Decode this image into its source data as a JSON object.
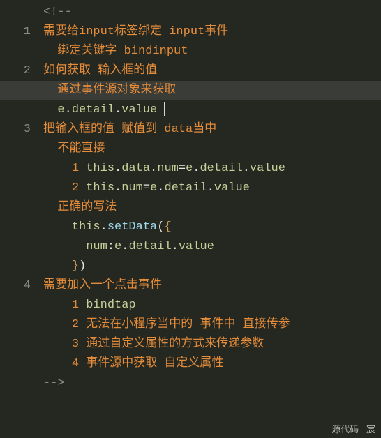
{
  "lines": [
    {
      "num": "",
      "hl": false,
      "segs": [
        {
          "c": "g",
          "t": "<!-- "
        }
      ],
      "indent": -1
    },
    {
      "num": "1",
      "hl": false,
      "segs": [
        {
          "c": "o",
          "t": "需要给input标签绑定 input事件"
        }
      ],
      "indent": 0
    },
    {
      "num": "",
      "hl": false,
      "segs": [
        {
          "c": "o",
          "t": "绑定关键字 bindinput"
        }
      ],
      "indent": 1
    },
    {
      "num": "2",
      "hl": false,
      "segs": [
        {
          "c": "o",
          "t": "如何获取 输入框的值"
        }
      ],
      "indent": 0
    },
    {
      "num": "",
      "hl": true,
      "segs": [
        {
          "c": "o",
          "t": "通过事件源对象来获取"
        }
      ],
      "indent": 1
    },
    {
      "num": "",
      "hl": false,
      "segs": [
        {
          "c": "lg",
          "t": "e"
        },
        {
          "c": "w",
          "t": "."
        },
        {
          "c": "lg",
          "t": "detail"
        },
        {
          "c": "w",
          "t": "."
        },
        {
          "c": "lg",
          "t": "value"
        }
      ],
      "indent": 1,
      "cursor": true
    },
    {
      "num": "3",
      "hl": false,
      "segs": [
        {
          "c": "o",
          "t": "把输入框的值 赋值到 data当中"
        }
      ],
      "indent": 0
    },
    {
      "num": "",
      "hl": false,
      "segs": [
        {
          "c": "o",
          "t": "不能直接 "
        }
      ],
      "indent": 1
    },
    {
      "num": "",
      "hl": false,
      "segs": [
        {
          "c": "o",
          "t": "1 "
        },
        {
          "c": "lg",
          "t": "this"
        },
        {
          "c": "w",
          "t": "."
        },
        {
          "c": "lg",
          "t": "data"
        },
        {
          "c": "w",
          "t": "."
        },
        {
          "c": "lg",
          "t": "num"
        },
        {
          "c": "w",
          "t": "="
        },
        {
          "c": "lg",
          "t": "e"
        },
        {
          "c": "w",
          "t": "."
        },
        {
          "c": "lg",
          "t": "detail"
        },
        {
          "c": "w",
          "t": "."
        },
        {
          "c": "lg",
          "t": "value"
        }
      ],
      "indent": 2
    },
    {
      "num": "",
      "hl": false,
      "segs": [
        {
          "c": "o",
          "t": "2 "
        },
        {
          "c": "lg",
          "t": "this"
        },
        {
          "c": "w",
          "t": "."
        },
        {
          "c": "lg",
          "t": "num"
        },
        {
          "c": "w",
          "t": "="
        },
        {
          "c": "lg",
          "t": "e"
        },
        {
          "c": "w",
          "t": "."
        },
        {
          "c": "lg",
          "t": "detail"
        },
        {
          "c": "w",
          "t": "."
        },
        {
          "c": "lg",
          "t": "value"
        }
      ],
      "indent": 2
    },
    {
      "num": "",
      "hl": false,
      "segs": [
        {
          "c": "o",
          "t": "正确的写法"
        }
      ],
      "indent": 1
    },
    {
      "num": "",
      "hl": false,
      "segs": [
        {
          "c": "lg",
          "t": "this"
        },
        {
          "c": "w",
          "t": "."
        },
        {
          "c": "bl",
          "t": "setData"
        },
        {
          "c": "w",
          "t": "("
        },
        {
          "c": "br",
          "t": "{"
        }
      ],
      "indent": 2
    },
    {
      "num": "",
      "hl": false,
      "segs": [
        {
          "c": "lg",
          "t": "num"
        },
        {
          "c": "w",
          "t": ":"
        },
        {
          "c": "lg",
          "t": "e"
        },
        {
          "c": "w",
          "t": "."
        },
        {
          "c": "lg",
          "t": "detail"
        },
        {
          "c": "w",
          "t": "."
        },
        {
          "c": "lg",
          "t": "value"
        }
      ],
      "indent": 3
    },
    {
      "num": "",
      "hl": false,
      "segs": [
        {
          "c": "br",
          "t": "}"
        },
        {
          "c": "w",
          "t": ")"
        }
      ],
      "indent": 2
    },
    {
      "num": "4",
      "hl": false,
      "segs": [
        {
          "c": "o",
          "t": "需要加入一个点击事件"
        }
      ],
      "indent": 0
    },
    {
      "num": "",
      "hl": false,
      "segs": [
        {
          "c": "o",
          "t": "1 "
        },
        {
          "c": "lg",
          "t": "bindtap"
        }
      ],
      "indent": 2
    },
    {
      "num": "",
      "hl": false,
      "segs": [
        {
          "c": "o",
          "t": "2 无法在小程序当中的 事件中 直接传参"
        }
      ],
      "indent": 2
    },
    {
      "num": "",
      "hl": false,
      "segs": [
        {
          "c": "o",
          "t": "3 通过自定义属性的方式来传递参数"
        }
      ],
      "indent": 2
    },
    {
      "num": "",
      "hl": false,
      "segs": [
        {
          "c": "o",
          "t": "4 事件源中获取 自定义属性"
        }
      ],
      "indent": 2
    },
    {
      "num": "",
      "hl": false,
      "segs": [
        {
          "c": "g",
          "t": "-->"
        }
      ],
      "indent": -1
    }
  ],
  "statusbar": {
    "left": "源代码",
    "right": "宸"
  }
}
